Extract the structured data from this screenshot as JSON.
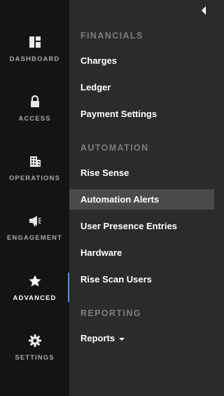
{
  "rail": {
    "items": [
      {
        "label": "DASHBOARD",
        "icon": "dashboard-icon"
      },
      {
        "label": "ACCESS",
        "icon": "lock-icon"
      },
      {
        "label": "OPERATIONS",
        "icon": "building-icon"
      },
      {
        "label": "ENGAGEMENT",
        "icon": "megaphone-icon"
      },
      {
        "label": "ADVANCED",
        "icon": "star-icon",
        "active": true
      },
      {
        "label": "SETTINGS",
        "icon": "gear-icon"
      }
    ],
    "accent_color": "#4a90d9"
  },
  "panel": {
    "collapse_icon": "caret-left-icon",
    "sections": [
      {
        "title": "FINANCIALS",
        "items": [
          "Charges",
          "Ledger",
          "Payment Settings"
        ]
      },
      {
        "title": "AUTOMATION",
        "items": [
          "Rise Sense",
          "Automation Alerts",
          "User Presence Entries",
          "Hardware",
          "Rise Scan Users"
        ]
      },
      {
        "title": "REPORTING",
        "items": [
          "Reports"
        ]
      }
    ],
    "active_item": "Automation Alerts"
  }
}
